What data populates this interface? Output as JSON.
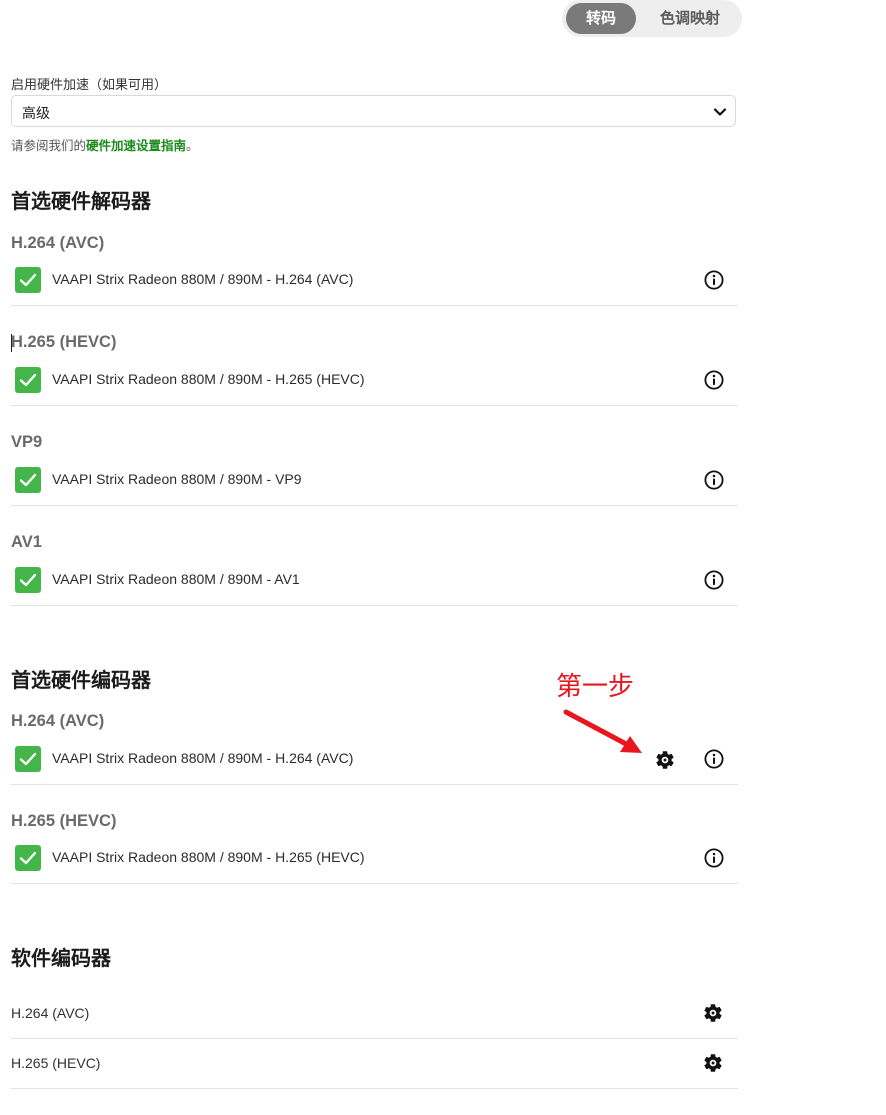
{
  "tabs": {
    "active": "转码",
    "inactive": "色调映射"
  },
  "hw_accel": {
    "label": "启用硬件加速（如果可用）",
    "selected": "高级",
    "hint_prefix": "请参阅我们的",
    "hint_link": "硬件加速设置指南",
    "hint_suffix": "。"
  },
  "decoders": {
    "title": "首选硬件解码器",
    "items": [
      {
        "codec": "H.264 (AVC)",
        "device": "VAAPI Strix Radeon 880M / 890M - H.264 (AVC)",
        "checked": true
      },
      {
        "codec": "H.265 (HEVC)",
        "device": "VAAPI Strix Radeon 880M / 890M - H.265 (HEVC)",
        "checked": true
      },
      {
        "codec": "VP9",
        "device": "VAAPI Strix Radeon 880M / 890M - VP9",
        "checked": true
      },
      {
        "codec": "AV1",
        "device": "VAAPI Strix Radeon 880M / 890M - AV1",
        "checked": true
      }
    ]
  },
  "encoders": {
    "title": "首选硬件编码器",
    "items": [
      {
        "codec": "H.264 (AVC)",
        "device": "VAAPI Strix Radeon 880M / 890M - H.264 (AVC)",
        "checked": true
      },
      {
        "codec": "H.265 (HEVC)",
        "device": "VAAPI Strix Radeon 880M / 890M - H.265 (HEVC)",
        "checked": true
      }
    ]
  },
  "software": {
    "title": "软件编码器",
    "items": [
      {
        "label": "H.264 (AVC)"
      },
      {
        "label": "H.265 (HEVC)"
      }
    ]
  },
  "annotation": {
    "text": "第一步",
    "color": "#e8161f"
  },
  "colors": {
    "check": "#43b549",
    "link": "#1b8a1b",
    "tab_active_bg": "#7a7a7a"
  },
  "icons": [
    "chevron-down-icon",
    "checkmark-icon",
    "info-icon",
    "gear-icon",
    "arrow-icon"
  ]
}
